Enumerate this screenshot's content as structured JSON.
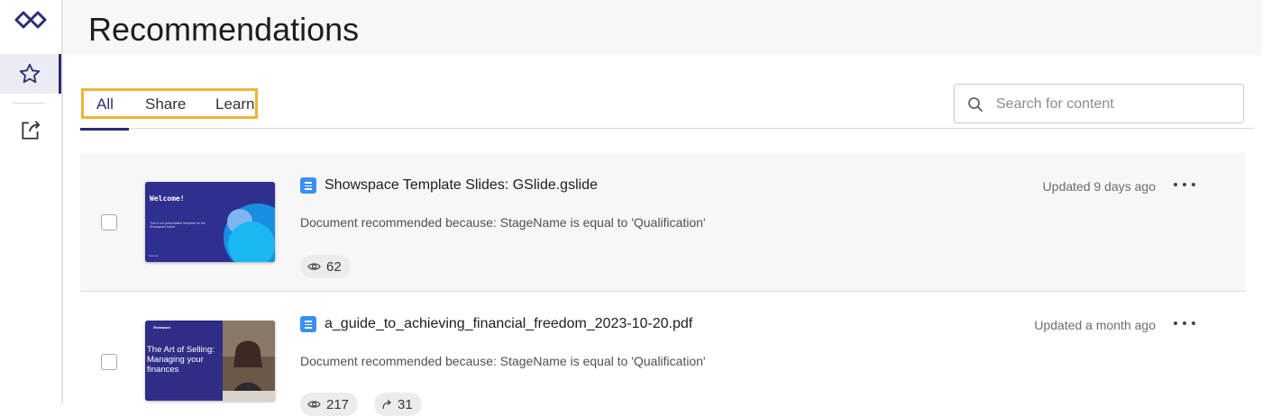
{
  "page": {
    "title": "Recommendations"
  },
  "sidebar": {
    "items": [
      {
        "icon": "star-icon",
        "active": true
      },
      {
        "icon": "share-out-icon",
        "active": false
      }
    ]
  },
  "tabs": [
    {
      "label": "All",
      "active": true
    },
    {
      "label": "Share",
      "active": false
    },
    {
      "label": "Learn",
      "active": false
    }
  ],
  "search": {
    "placeholder": "Search for content",
    "value": ""
  },
  "documents": [
    {
      "name": "Showspace Template Slides: GSlide.gslide",
      "updated": "Updated 9 days ago",
      "reason": "Document recommended because: StageName is equal to 'Qualification'",
      "views": "62",
      "thumbnail": {
        "heading": "Welcome!",
        "subtitle": "This is our presentation template for the Showspace brand",
        "footer": "Seismic"
      }
    },
    {
      "name": "a_guide_to_achieving_financial_freedom_2023-10-20.pdf",
      "updated": "Updated a month ago",
      "reason": "Document recommended because: StageName is equal to 'Qualification'",
      "views": "217",
      "shares": "31",
      "thumbnail": {
        "brand": "Showspace",
        "heading": "The Art of Selling: Managing your finances"
      }
    }
  ],
  "colors": {
    "accent": "#2b2d72",
    "highlight": "#f0b437",
    "file_icon": "#3b8ff3"
  }
}
